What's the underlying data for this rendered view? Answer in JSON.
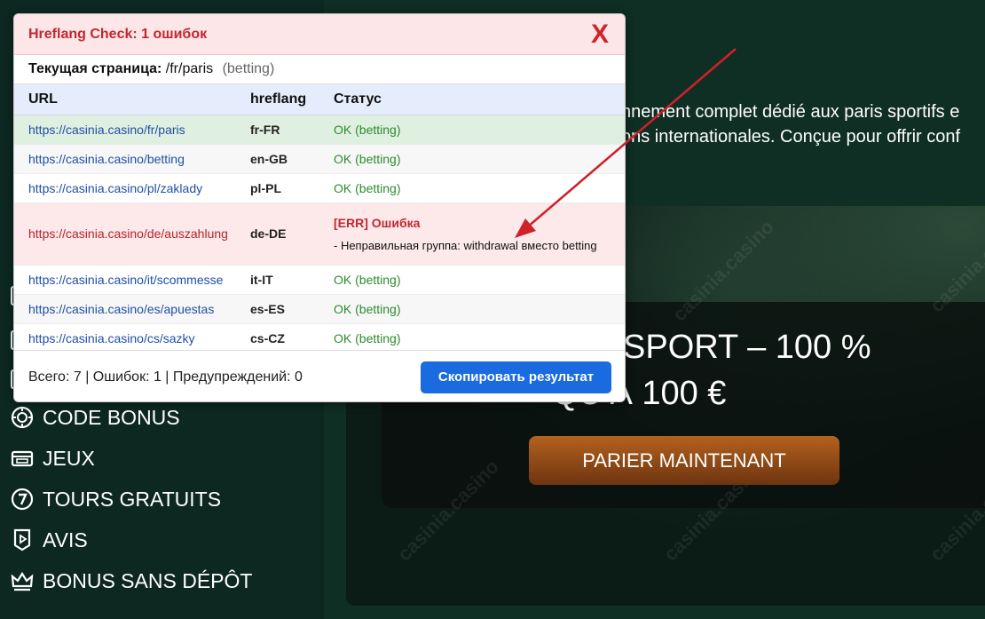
{
  "popup": {
    "title": "Hreflang Check: 1 ошибок",
    "close_label": "X",
    "current_label": "Текущая страница:",
    "current_path": "/fr/paris",
    "current_group": "(betting)",
    "columns": {
      "url": "URL",
      "hreflang": "hreflang",
      "status": "Статус"
    },
    "rows": [
      {
        "url": "https://casinia.casino/fr/paris",
        "hreflang": "fr-FR",
        "status": "OK (betting)"
      },
      {
        "url": "https://casinia.casino/betting",
        "hreflang": "en-GB",
        "status": "OK (betting)"
      },
      {
        "url": "https://casinia.casino/pl/zaklady",
        "hreflang": "pl-PL",
        "status": "OK (betting)"
      },
      {
        "url": "https://casinia.casino/de/auszahlung",
        "hreflang": "de-DE",
        "status": "[ERR] Ошибка",
        "detail": "- Неправильная группа: withdrawal вместо betting"
      },
      {
        "url": "https://casinia.casino/it/scommesse",
        "hreflang": "it-IT",
        "status": "OK (betting)"
      },
      {
        "url": "https://casinia.casino/es/apuestas",
        "hreflang": "es-ES",
        "status": "OK (betting)"
      },
      {
        "url": "https://casinia.casino/cs/sazky",
        "hreflang": "cs-CZ",
        "status": "OK (betting)"
      }
    ],
    "summary": "Всего: 7 | Ошибок: 1 | Предупреждений: 0",
    "copy_button": "Скопировать результат"
  },
  "site": {
    "intro_line1": "nnement complet dédié aux paris sportifs e",
    "intro_line2": "ons internationales. Conçue pour offrir conf",
    "hero_line1": "SPORT – 100 %",
    "hero_line2": "QU’À 100 €",
    "cta": "PARIER MAINTENANT",
    "watermark": "casinia.casino",
    "nav": [
      {
        "label": "CODE BONUS",
        "icon": "chip-icon"
      },
      {
        "label": "JEUX",
        "icon": "ticket-icon"
      },
      {
        "label": "TOURS GRATUITS",
        "icon": "seven-icon"
      },
      {
        "label": "AVIS",
        "icon": "play-badge-icon"
      },
      {
        "label": "BONUS SANS DÉPÔT",
        "icon": "crown-icon"
      }
    ]
  },
  "colors": {
    "error": "#c0282f",
    "ok": "#2e8b2e",
    "link": "#1f4fa6",
    "button": "#1a6ae0",
    "annotation_arrow": "#d0202a"
  }
}
